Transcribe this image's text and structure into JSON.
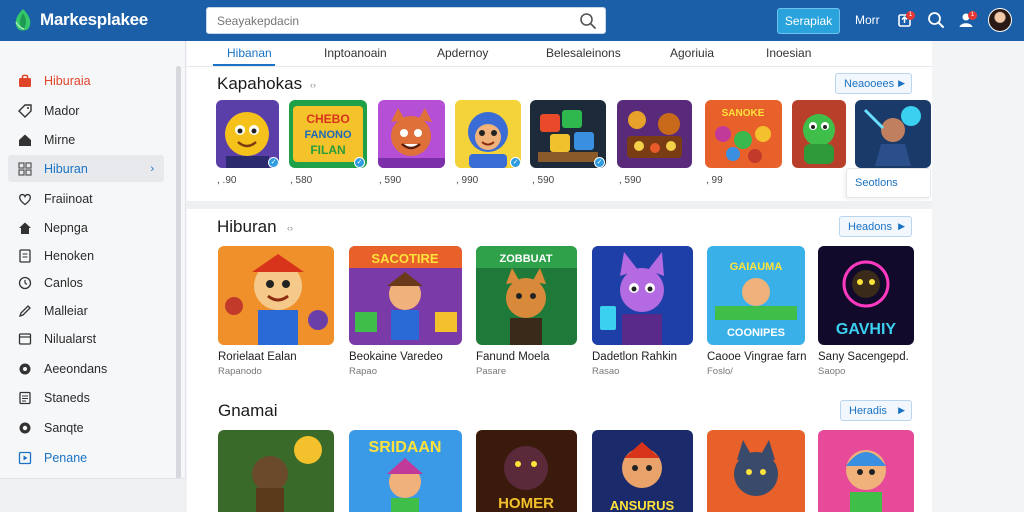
{
  "header": {
    "app_name": "Markesplakee",
    "search_placeholder": "Seayakepdacin",
    "signup_label": "Serapiak",
    "more_label": "Morr",
    "notif_badge_1": "1",
    "notif_badge_2": "1"
  },
  "sidebar": {
    "items": [
      {
        "label": "Hiburaia"
      },
      {
        "label": "Mador"
      },
      {
        "label": "Mirne"
      },
      {
        "label": "Hiburan"
      },
      {
        "label": "Fraiinoat"
      },
      {
        "label": "Nepnga"
      },
      {
        "label": "Henoken"
      },
      {
        "label": "Canlos"
      },
      {
        "label": "Malleiar"
      },
      {
        "label": "Nilualarst"
      },
      {
        "label": "Aeeondans"
      },
      {
        "label": "Staneds"
      },
      {
        "label": "Sanqte"
      },
      {
        "label": "Penane"
      }
    ]
  },
  "tabs": [
    "Hibanan",
    "Inptoanoain",
    "Apdernoy",
    "Belesaleinons",
    "Agoriuia",
    "Inoesian"
  ],
  "section1": {
    "title": "Kapahokas",
    "arrow": "‹›",
    "see_all": "Neaooees",
    "prices": [
      ", .90",
      ", 580",
      ", 590",
      ", 990",
      ", 590",
      ", 590",
      ", 99"
    ],
    "more_label": "Seotlons"
  },
  "section2": {
    "title": "Hiburan",
    "arrow": "‹›",
    "see_all": "Headons",
    "games": [
      {
        "title": "Rorielaat Ealan",
        "sub": "Rapanodo"
      },
      {
        "title": "Beokaine Varedeo",
        "sub": "Rapao"
      },
      {
        "title": "Fanund Moela",
        "sub": "Pasare"
      },
      {
        "title": "Dadetlon Rahkin",
        "sub": "Rasao"
      },
      {
        "title": "Caooe Vingrae farn",
        "sub": "Foslo/"
      },
      {
        "title": "Sany Sacengepd.",
        "sub": "Saopo"
      }
    ]
  },
  "section3": {
    "title": "Gnamai",
    "see_all": "Heradis"
  },
  "art_text": {
    "s1_2": "CHEBO",
    "s1_2b": "FANONO",
    "s1_2c": "FILAN",
    "s1_7": "SANOKE",
    "s2_2": "SACOTIRE",
    "s2_3": "ZOBBUAT",
    "s2_5a": "GAIAUMA",
    "s2_5b": "COONIPES",
    "s2_6": "GAVHIY",
    "s3_2": "SRIDAAN",
    "s3_3": "HOMER",
    "s3_4": "ANSURUS"
  },
  "colors": {
    "header": "#1a5fa8",
    "accent": "#1a73c4",
    "signup": "#2aa3dc",
    "active_red": "#e0452a"
  }
}
